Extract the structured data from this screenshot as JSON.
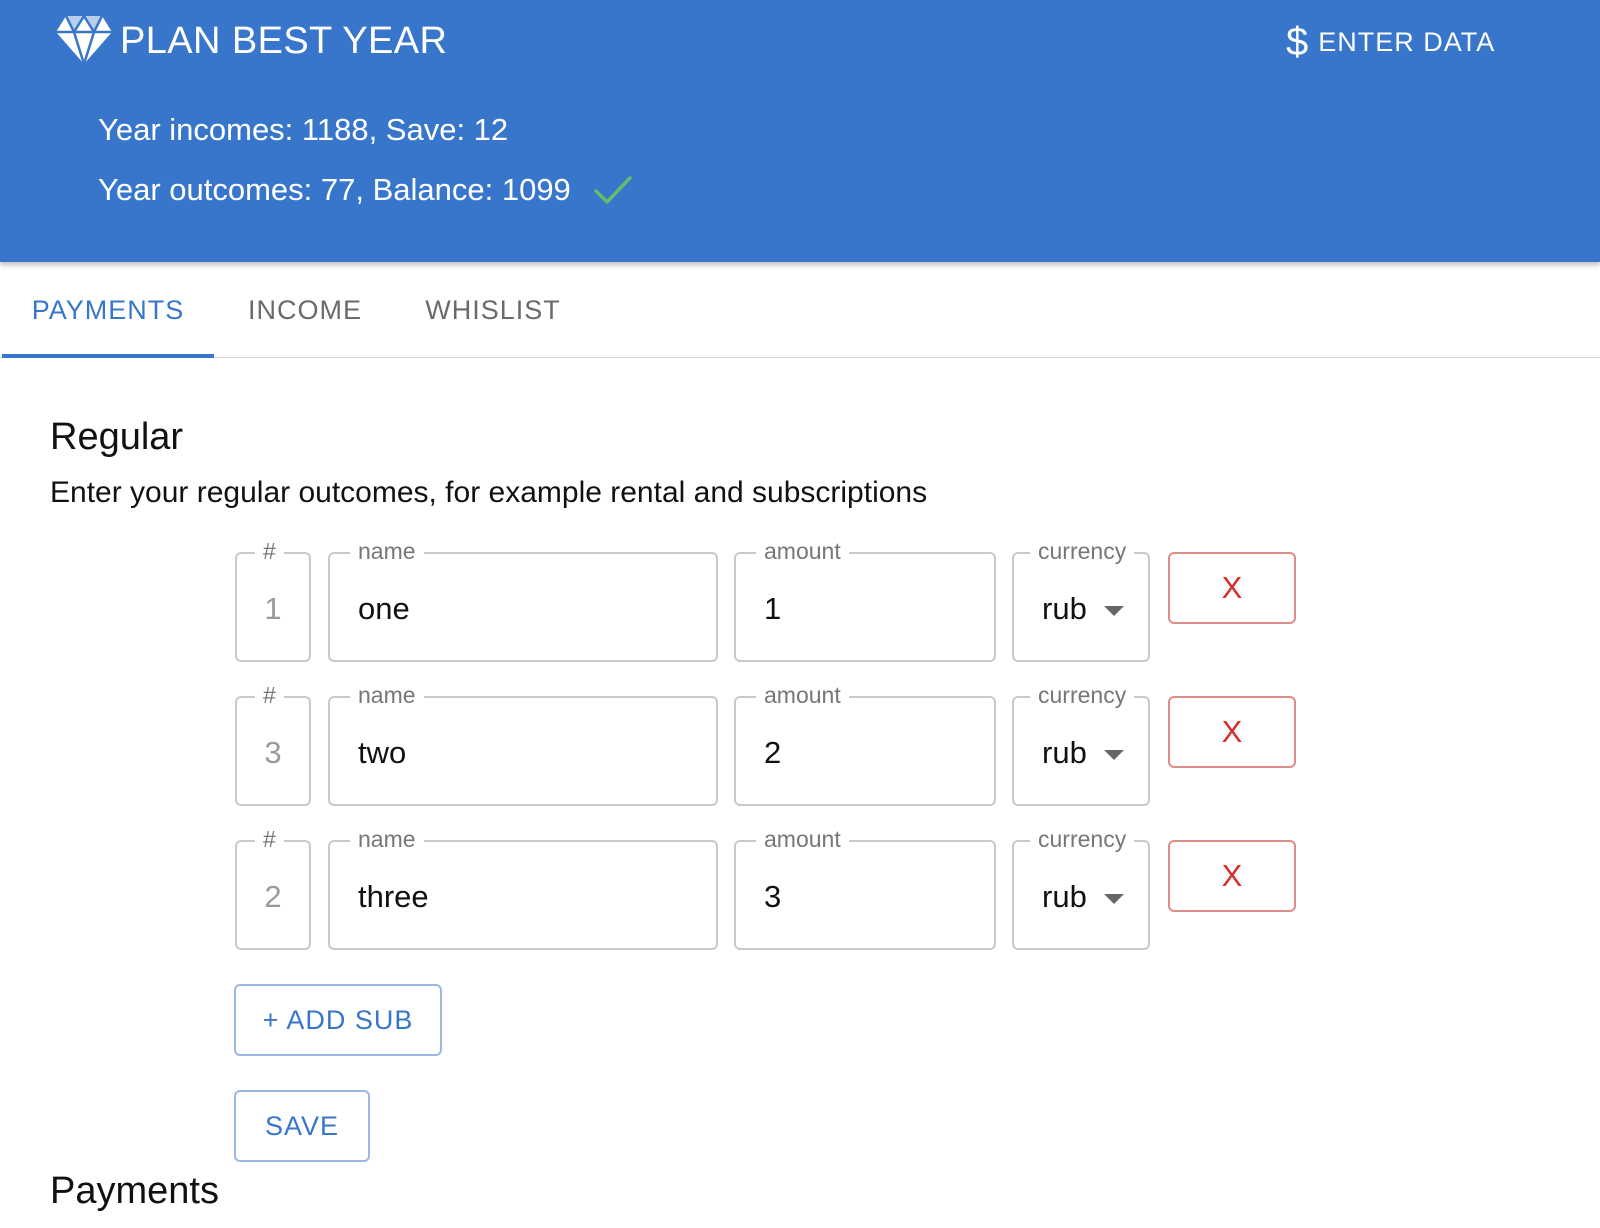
{
  "app": {
    "title": "PLAN BEST YEAR",
    "logo_icon": "diamond-icon",
    "enter_data_icon": "dollar-icon",
    "enter_data_symbol": "$",
    "enter_data_label": "ENTER DATA",
    "stats_line1": "Year incomes: 1188, Save: 12",
    "stats_line2": "Year outcomes: 77, Balance: 1099",
    "status_icon": "check-icon",
    "colors": {
      "primary": "#3876cc",
      "success": "#66bb6a",
      "danger": "#d32f2f"
    }
  },
  "tabs": [
    {
      "label": "PAYMENTS",
      "active": true
    },
    {
      "label": "INCOME",
      "active": false
    },
    {
      "label": "WHISLIST",
      "active": false
    }
  ],
  "regular": {
    "title": "Regular",
    "description": "Enter your regular outcomes, for example rental and subscriptions",
    "labels": {
      "num": "#",
      "name": "name",
      "amount": "amount",
      "currency": "currency"
    },
    "rows": [
      {
        "num": "1",
        "name": "one",
        "amount": "1",
        "currency": "rub",
        "delete_label": "X"
      },
      {
        "num": "3",
        "name": "two",
        "amount": "2",
        "currency": "rub",
        "delete_label": "X"
      },
      {
        "num": "2",
        "name": "three",
        "amount": "3",
        "currency": "rub",
        "delete_label": "X"
      }
    ],
    "add_label": "+ ADD SUB",
    "save_label": "SAVE"
  },
  "payments": {
    "title": "Payments"
  }
}
